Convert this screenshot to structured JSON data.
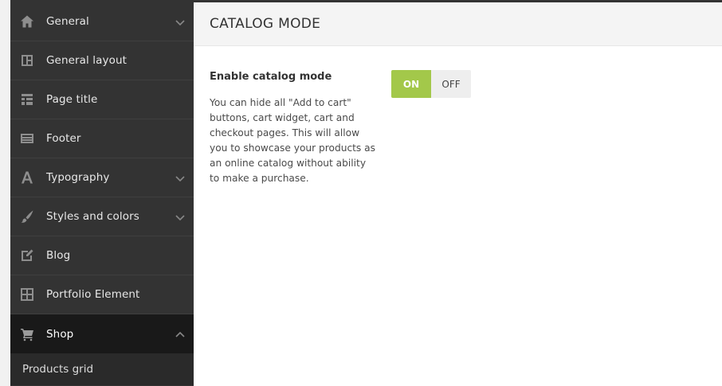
{
  "sidebar": {
    "items": [
      {
        "label": "General",
        "icon": "home-icon",
        "has_chevron": true,
        "expanded": false
      },
      {
        "label": "General layout",
        "icon": "layout-icon",
        "has_chevron": false
      },
      {
        "label": "Page title",
        "icon": "page-title-icon",
        "has_chevron": false
      },
      {
        "label": "Footer",
        "icon": "footer-icon",
        "has_chevron": false
      },
      {
        "label": "Typography",
        "icon": "typography-icon",
        "has_chevron": true,
        "expanded": false
      },
      {
        "label": "Styles and colors",
        "icon": "brush-icon",
        "has_chevron": true,
        "expanded": false
      },
      {
        "label": "Blog",
        "icon": "edit-icon",
        "has_chevron": false
      },
      {
        "label": "Portfolio Element",
        "icon": "grid-icon",
        "has_chevron": false
      },
      {
        "label": "Shop",
        "icon": "cart-icon",
        "has_chevron": true,
        "expanded": true,
        "active": true
      }
    ],
    "subitems": [
      {
        "label": "Products grid"
      }
    ]
  },
  "main": {
    "title": "CATALOG MODE",
    "option": {
      "title": "Enable catalog mode",
      "description": "You can hide all \"Add to cart\" buttons, cart widget, cart and checkout pages. This will allow you to showcase your products as an online catalog without ability to make a purchase.",
      "toggle": {
        "on_label": "ON",
        "off_label": "OFF",
        "state": "on"
      }
    }
  },
  "colors": {
    "sidebar_bg": "#333333",
    "sidebar_active_bg": "#191919",
    "toggle_on": "#a3c84a",
    "toggle_off": "#eeeeee",
    "header_bg": "#f4f4f4"
  }
}
